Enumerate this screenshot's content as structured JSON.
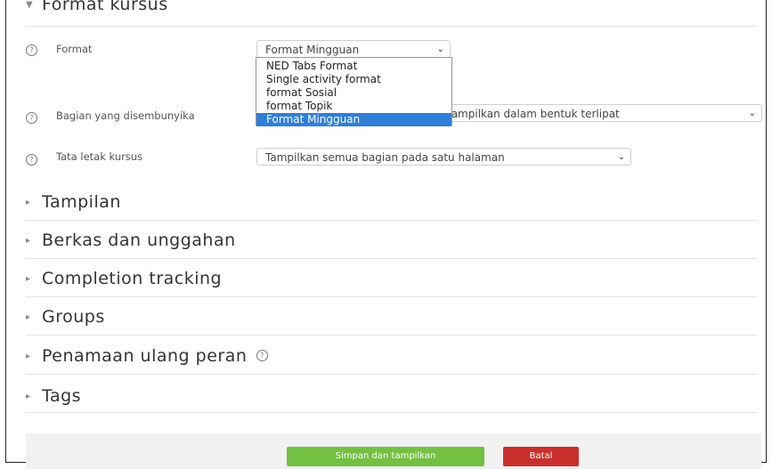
{
  "top_section": {
    "title": "Format kursus"
  },
  "fields": {
    "format": {
      "label": "Format",
      "value": "Format Mingguan"
    },
    "hidden_sections": {
      "label": "Bagian yang disembunyika",
      "value": "tampilkan dalam bentuk terlipat"
    },
    "layout": {
      "label": "Tata letak kursus",
      "value": "Tampilkan semua bagian pada satu halaman"
    }
  },
  "format_dropdown": {
    "options": [
      "NED Tabs Format",
      "Single activity format",
      "format Sosial",
      "format Topik",
      "Format Mingguan"
    ],
    "selected": "Format Mingguan"
  },
  "collapsed_sections": [
    "Tampilan",
    "Berkas dan unggahan",
    "Completion tracking",
    "Groups",
    "Penamaan ulang peran",
    "Tags"
  ],
  "buttons": {
    "save": "Simpan dan tampilkan",
    "cancel": "Batal"
  },
  "icons": {
    "help": "help-icon",
    "expand": "triangle-right-icon",
    "collapse": "triangle-down-icon",
    "select_arrow": "chevron-down-icon"
  },
  "colors": {
    "save_button": "#74c043",
    "cancel_button": "#c9302c",
    "dropdown_selected": "#2f7fd8"
  }
}
